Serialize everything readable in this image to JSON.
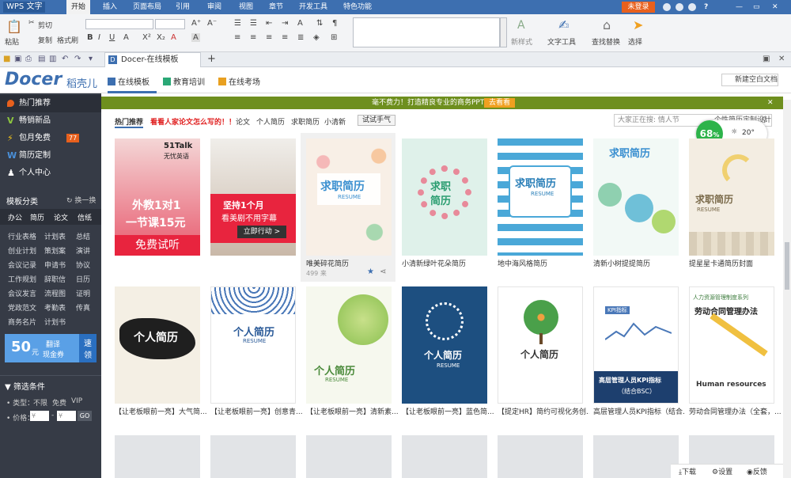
{
  "titlebar": {
    "app": "WPS 文字",
    "menus": [
      "开始",
      "插入",
      "页面布局",
      "引用",
      "审阅",
      "视图",
      "章节",
      "开发工具",
      "特色功能"
    ],
    "login": "未登录",
    "help": "?"
  },
  "ribbon": {
    "paste": "粘贴",
    "cut": "剪切",
    "copy": "复制",
    "format_painter": "格式刷",
    "new_style": "新样式",
    "text_tools": "文字工具",
    "find_replace": "查找替换",
    "select": "选择"
  },
  "qat": {
    "doc_tab": "Docer-在线模板",
    "new_tab": "+"
  },
  "docer": {
    "logo": "Docer",
    "logo_cn": "稻壳儿",
    "tabs": [
      "在线模板",
      "教育培训",
      "在线考场"
    ],
    "new_blank": "新建空白文档"
  },
  "sidebar": {
    "nav": [
      {
        "label": "热门推荐",
        "icon": "flame-icon",
        "color": "#e8601d"
      },
      {
        "label": "畅销新品",
        "icon": "v-icon",
        "color": "#8dc63f"
      },
      {
        "label": "包月免费",
        "icon": "bolt-icon",
        "color": "#f5c518",
        "badge": "77"
      },
      {
        "label": "简历定制",
        "icon": "w-icon",
        "color": "#4a90d9"
      },
      {
        "label": "个人中心",
        "icon": "person-icon",
        "color": "#ffffff"
      }
    ],
    "category_title": "模板分类",
    "switch": "换一换",
    "type_tabs": [
      "办公",
      "简历",
      "论文",
      "信纸"
    ],
    "grid": [
      [
        "行业表格",
        "计划表",
        "总结"
      ],
      [
        "创业计划",
        "策划案",
        "演讲"
      ],
      [
        "会议记录",
        "申请书",
        "协议"
      ],
      [
        "工作规划",
        "辞职信",
        "日历"
      ],
      [
        "会议发言",
        "流程图",
        "证明"
      ],
      [
        "党政范文",
        "考勤表",
        "传真"
      ],
      [
        "商务名片",
        "计划书",
        ""
      ]
    ],
    "ad": {
      "value": "50",
      "unit": "元",
      "line1": "翻译",
      "line2": "现金券",
      "cta1": "速",
      "cta2": "领"
    },
    "filter_title": "筛选条件",
    "type_label": "• 类型：",
    "types": [
      "不限",
      "免费",
      "VIP"
    ],
    "price_label": "• 价格：",
    "price_from": "¥",
    "price_sep": "-",
    "price_to": "¥",
    "go": "GO"
  },
  "main": {
    "banner_text": "毫不费力！打造精良专业的商务PPT",
    "banner_cta": "去看看",
    "filters": [
      "热门推荐",
      "论文",
      "个人简历",
      "求职简历",
      "小清新"
    ],
    "promo": "看看人家论文怎么写的！！",
    "try_btn": "试试手气",
    "search_placeholder": "大家正在搜: 情人节",
    "search_right": "个性简历定制设计",
    "weather": {
      "percent": "68",
      "unit": "%",
      "temp": "20°"
    },
    "row1": [
      {
        "title": "",
        "img_top": "51Talk",
        "img_sub": "无忧英语",
        "img_main1": "外教1对1",
        "img_main2": "一节课15元",
        "img_cta": "免费试听",
        "style": "ad1"
      },
      {
        "title": "",
        "img_main1": "坚持1个月",
        "img_main2": "看美剧不用字幕",
        "img_cta": "立即行动 >",
        "style": "ad2"
      },
      {
        "title": "唯美碎花简历",
        "img_main1": "求职简历",
        "img_sub": "RESUME",
        "style": "floral",
        "count": "499",
        "count_unit": "来"
      },
      {
        "title": "小清新绿叶花朵简历",
        "img_main1": "求职",
        "img_main2": "简历",
        "style": "wreath"
      },
      {
        "title": "地中海风格简历",
        "img_main1": "求职简历",
        "img_sub": "RESUME",
        "style": "stripes"
      },
      {
        "title": "清新小树提提简历",
        "img_main1": "求职简历",
        "style": "trees"
      },
      {
        "title": "提星星卡通简历封面",
        "img_main1": "求职简历",
        "img_sub": "RESUME",
        "style": "moon"
      }
    ],
    "row2": [
      {
        "title": "【让老板眼前一亮】大气简...",
        "img_main1": "个人简历",
        "style": "ink"
      },
      {
        "title": "【让老板眼前一亮】创意青...",
        "img_main1": "个人简历",
        "img_sub": "RESUME",
        "style": "porcelain"
      },
      {
        "title": "【让老板眼前一亮】清新素...",
        "img_main1": "个人简历",
        "img_sub": "RESUME",
        "style": "vines"
      },
      {
        "title": "【让老板眼前一亮】蓝色简...",
        "img_main1": "个人简历",
        "img_sub": "RESUME",
        "style": "bluetree"
      },
      {
        "title": "【提定HR】简约可视化务创...",
        "img_main1": "个人简历",
        "style": "greentree"
      },
      {
        "title": "高层管理人员KPI指标（结合...",
        "img_main1": "高层管理人员KPI指标",
        "img_main2": "（结合BSC）",
        "img_top": "KPI指标",
        "style": "kpi"
      },
      {
        "title": "劳动合同管理办法（全套，...",
        "img_main1": "劳动合同管理办法",
        "img_top": "人力资源管理制度系列",
        "img_sub": "Human resources",
        "style": "pencil"
      }
    ],
    "bottom": {
      "download": "下载",
      "settings": "设置",
      "feedback": "反馈"
    }
  },
  "colors": {
    "accent": "#e8601d",
    "sidebar": "#363b46",
    "banner": "#6e8f1e",
    "wps_blue": "#3d6fb0"
  }
}
